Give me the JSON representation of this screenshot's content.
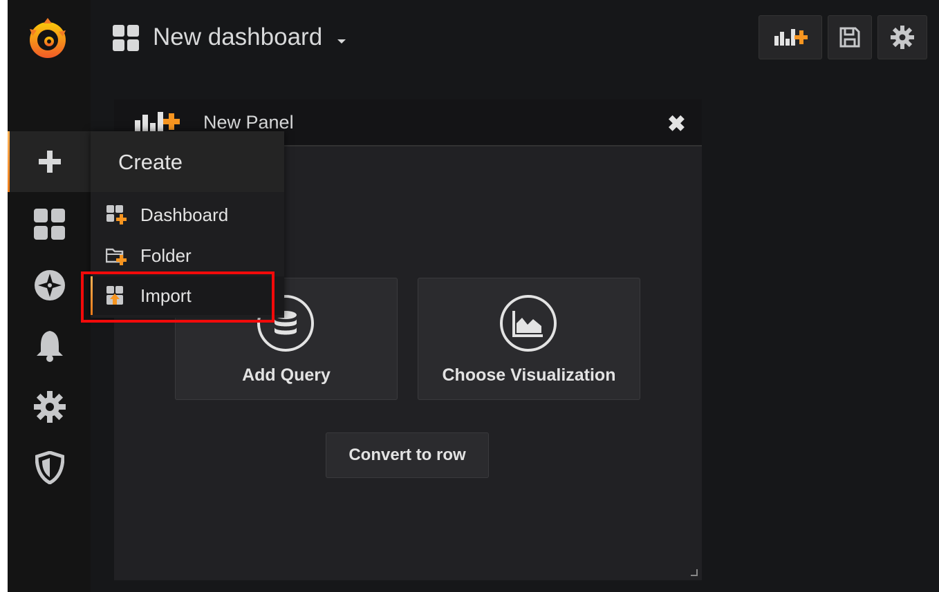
{
  "header": {
    "title": "New dashboard"
  },
  "panel": {
    "title": "New Panel",
    "close_label": "✖",
    "add_query_label": "Add Query",
    "choose_visualization_label": "Choose Visualization",
    "convert_to_row_label": "Convert to row"
  },
  "create_menu": {
    "title": "Create",
    "items": [
      {
        "label": "Dashboard",
        "icon": "dashboard-plus-icon"
      },
      {
        "label": "Folder",
        "icon": "folder-plus-icon"
      },
      {
        "label": "Import",
        "icon": "import-icon",
        "active": true
      }
    ]
  },
  "sidebar": {
    "items": [
      {
        "icon": "plus-icon",
        "active": true
      },
      {
        "icon": "dashboards-icon"
      },
      {
        "icon": "explore-icon"
      },
      {
        "icon": "bell-icon"
      },
      {
        "icon": "gear-icon"
      },
      {
        "icon": "shield-icon"
      }
    ]
  },
  "colors": {
    "accent": "#eb7b18",
    "highlight": "#f20a0a",
    "background": "#161719"
  }
}
